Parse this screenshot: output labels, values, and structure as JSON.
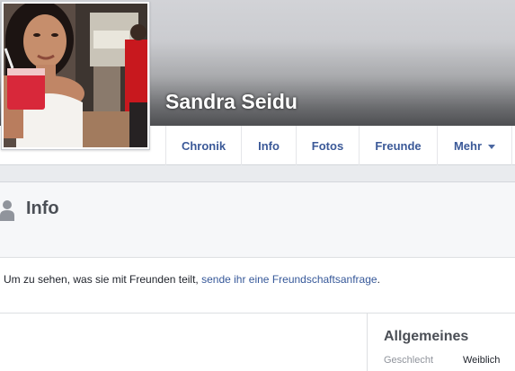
{
  "profile": {
    "name": "Sandra Seidu"
  },
  "tabs": [
    {
      "label": "Chronik"
    },
    {
      "label": "Info"
    },
    {
      "label": "Fotos"
    },
    {
      "label": "Freunde"
    },
    {
      "label": "Mehr",
      "icon": "caret-down-icon"
    }
  ],
  "info": {
    "title": "Info",
    "icon": "person-icon",
    "notice_text": "Um zu sehen, was sie mit Freunden teilt, ",
    "notice_link": "sende ihr eine Freundschaftsanfrage",
    "notice_end": "."
  },
  "general": {
    "title": "Allgemeines",
    "gender_label": "Geschlecht",
    "gender_value": "Weiblich"
  },
  "colors": {
    "link": "#365899",
    "tab_text": "#3b5998"
  }
}
